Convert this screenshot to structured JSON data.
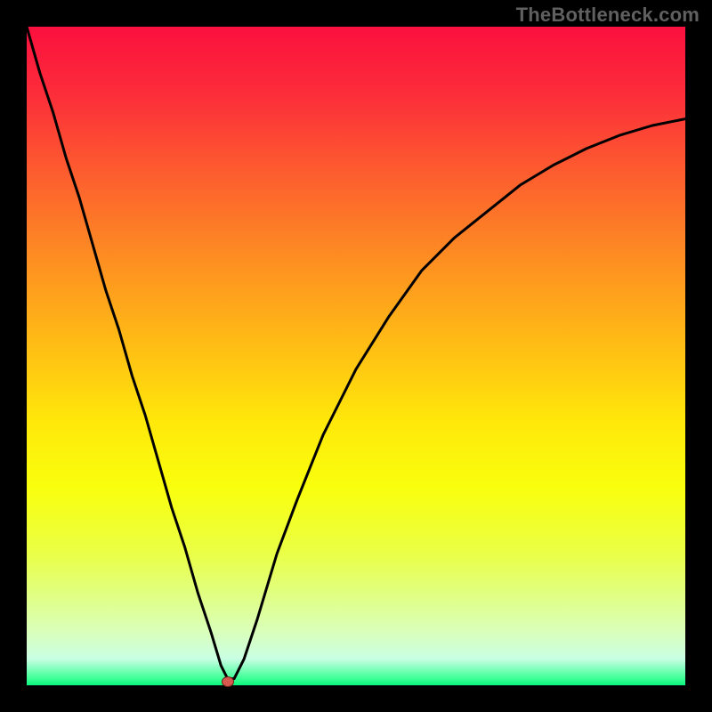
{
  "watermark": "TheBottleneck.com",
  "colors": {
    "page_bg": "#000000",
    "marker_fill": "#d6584e",
    "marker_stroke": "#6b1f1a",
    "curve_stroke": "#000000"
  },
  "chart_data": {
    "type": "line",
    "title": "",
    "xlabel": "",
    "ylabel": "",
    "xlim": [
      0,
      100
    ],
    "ylim": [
      0,
      100
    ],
    "x": [
      0,
      2,
      4,
      6,
      8,
      10,
      12,
      14,
      16,
      18,
      20,
      22,
      24,
      26,
      28,
      29.5,
      30.5,
      31.5,
      33,
      35,
      38,
      41,
      45,
      50,
      55,
      60,
      65,
      70,
      75,
      80,
      85,
      90,
      95,
      100
    ],
    "y": [
      100,
      93,
      87,
      80,
      74,
      67,
      60,
      54,
      47,
      41,
      34,
      27,
      21,
      14,
      8,
      3,
      1,
      1,
      4,
      10,
      20,
      28,
      38,
      48,
      56,
      63,
      68,
      72,
      76,
      79,
      81.5,
      83.5,
      85,
      86
    ],
    "marker": {
      "x": 30.5,
      "y": 0.5
    },
    "grid": false,
    "legend": false
  }
}
